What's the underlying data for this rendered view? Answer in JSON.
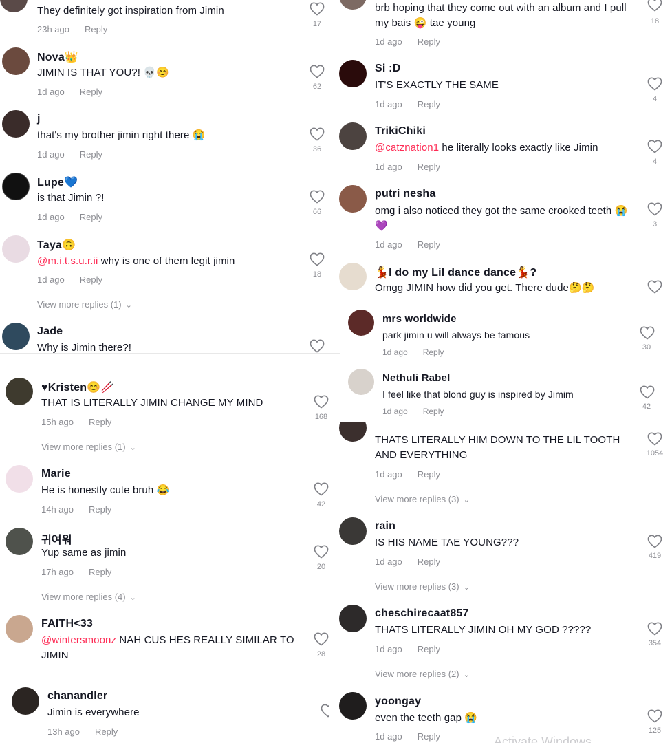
{
  "colors": {
    "text": "#161823",
    "muted": "rgba(22,24,35,0.5)",
    "mention": "#fe2c55",
    "background": "#ffffff"
  },
  "icons": {
    "like": "heart-outline-icon",
    "expand": "chevron-down-icon"
  },
  "reply_label": "Reply",
  "left": {
    "c0": {
      "text": "They definitely got inspiration from Jimin",
      "time": "23h ago",
      "likes": "17"
    },
    "c1": {
      "user": "Nova👑",
      "text": "JIMIN IS THAT YOU?! 💀😊",
      "time": "1d ago",
      "likes": "62"
    },
    "c2": {
      "user": "j",
      "text": "that's my brother jimin right there 😭",
      "time": "1d ago",
      "likes": "36"
    },
    "c3": {
      "user": "Lupe💙",
      "text": "is that Jimin ?!",
      "time": "1d ago",
      "likes": "66"
    },
    "c4": {
      "user": "Taya🙃",
      "mention": "@m.i.t.s.u.r.ii",
      "text": " why is one of them legit jimin",
      "time": "1d ago",
      "likes": "18",
      "more": "View more replies (1)"
    },
    "c5": {
      "user": "Jade",
      "text": "Why is Jimin there?!"
    },
    "c6": {
      "user": "♥Kristen😊🥢",
      "text": "THAT IS LITERALLY JIMIN CHANGE MY MIND",
      "time": "15h ago",
      "likes": "168",
      "more": "View more replies (1)"
    },
    "c7": {
      "user": "Marie",
      "text": "He is honestly cute bruh 😂",
      "time": "14h ago",
      "likes": "42"
    },
    "c8": {
      "user": "귀여워",
      "text": "Yup same as jimin",
      "time": "17h ago",
      "likes": "20",
      "more": "View more replies (4)"
    },
    "c9": {
      "user": "FAITH<33",
      "mention": "@wintersmoonz",
      "text": " NAH CUS HES REALLY SIMILAR TO JIMIN",
      "likes": "28"
    },
    "c10": {
      "user": "chanandler",
      "text": "Jimin is everywhere",
      "time": "13h ago"
    }
  },
  "right": {
    "r0": {
      "text": "brb hoping that they come out with an album and I pull my bais 😜 tae young",
      "time": "1d ago",
      "likes": "18"
    },
    "r1": {
      "user": "Si :D",
      "text": "IT'S EXACTLY THE SAME",
      "time": "1d ago",
      "likes": "4"
    },
    "r2": {
      "user": "TrikiChiki",
      "mention": "@catznation1",
      "text": " he literally looks exactly like Jimin",
      "time": "1d ago",
      "likes": "4"
    },
    "r3": {
      "user": "putri nesha",
      "text": "omg i also noticed they got the same crooked teeth 😭💜",
      "time": "1d ago",
      "likes": "3"
    },
    "r4": {
      "user": "💃I do my Lil dance dance💃?",
      "text": "Omgg JIMIN how did you get. There dude🤔🤔"
    },
    "r5": {
      "user": "mrs worldwide",
      "text": "park jimin u will always be famous",
      "time": "1d ago",
      "likes": "30"
    },
    "r6": {
      "user": "Nethuli Rabel",
      "text": "I feel like that blond guy is inspired by Jimim",
      "time": "1d ago",
      "likes": "42"
    },
    "r7": {
      "text": "THATS LITERALLY HIM DOWN TO THE LIL TOOTH AND EVERYTHING",
      "time": "1d ago",
      "likes": "1054",
      "more": "View more replies (3)"
    },
    "r8": {
      "user": "rain",
      "text": "IS HIS NAME TAE YOUNG???",
      "time": "1d ago",
      "likes": "419",
      "more": "View more replies (3)"
    },
    "r9": {
      "user": "cheschirecaat857",
      "text": "THATS LITERALLY JIMIN OH MY GOD ?????",
      "time": "1d ago",
      "likes": "354",
      "more": "View more replies (2)"
    },
    "r10": {
      "user": "yoongay",
      "text": "even the teeth gap 😭",
      "time": "1d ago",
      "likes": "125"
    }
  },
  "watermark": "Activate Windows"
}
